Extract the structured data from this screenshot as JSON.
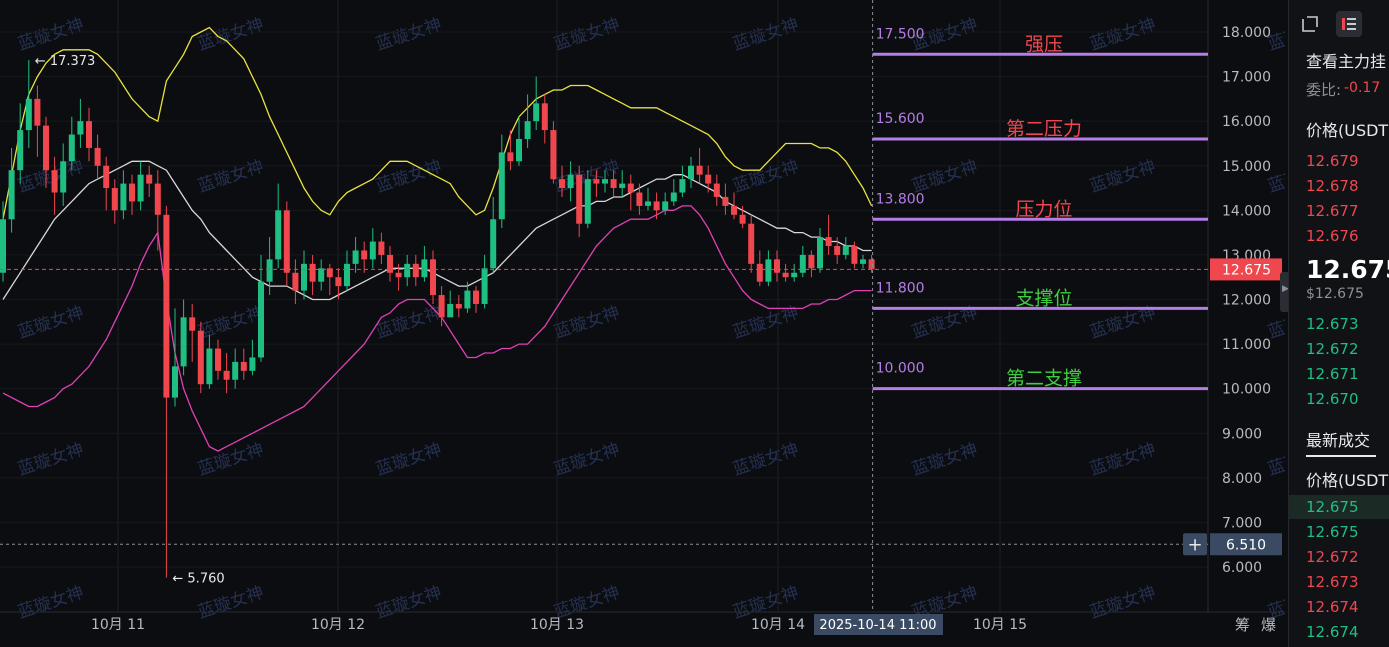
{
  "watermark": "蓝璇女神",
  "chart_data": {
    "type": "candlestick",
    "x_ticks": [
      "10月 11",
      "10月 12",
      "10月 13",
      "10月 14",
      "10月 15"
    ],
    "y_ticks": [
      "18.000",
      "17.000",
      "16.000",
      "15.000",
      "14.000",
      "13.000",
      "12.000",
      "11.000",
      "10.000",
      "9.000",
      "8.000",
      "7.000",
      "6.000"
    ],
    "ylim": [
      5.6,
      18.5
    ],
    "high_marker": "← 17.373",
    "low_marker": "← 5.760",
    "current_price": "12.675",
    "cursor_price": "6.510",
    "cursor_time": "2025-10-14 11:00",
    "levels": [
      {
        "value": 17.5,
        "value_label": "17.500",
        "name": "强压",
        "kind": "resistance"
      },
      {
        "value": 15.6,
        "value_label": "15.600",
        "name": "第二压力",
        "kind": "resistance"
      },
      {
        "value": 13.8,
        "value_label": "13.800",
        "name": "压力位",
        "kind": "resistance"
      },
      {
        "value": 11.8,
        "value_label": "11.800",
        "name": "支撑位",
        "kind": "support"
      },
      {
        "value": 10.0,
        "value_label": "10.000",
        "name": "第二支撑",
        "kind": "support"
      }
    ],
    "candles": [
      [
        12.6,
        13.8,
        14.2,
        12.4
      ],
      [
        13.8,
        14.9,
        15.4,
        13.5
      ],
      [
        14.9,
        15.8,
        16.4,
        14.6
      ],
      [
        15.8,
        16.5,
        17.373,
        15.4
      ],
      [
        16.5,
        15.9,
        16.8,
        15.2
      ],
      [
        15.9,
        14.9,
        16.1,
        14.5
      ],
      [
        14.9,
        14.4,
        15.2,
        13.9
      ],
      [
        14.4,
        15.1,
        15.5,
        14.1
      ],
      [
        15.1,
        15.7,
        16.1,
        14.9
      ],
      [
        15.7,
        16.0,
        16.5,
        15.4
      ],
      [
        16.0,
        15.4,
        16.3,
        15.1
      ],
      [
        15.4,
        15.0,
        15.7,
        14.7
      ],
      [
        15.0,
        14.5,
        15.2,
        14.0
      ],
      [
        14.5,
        14.0,
        14.7,
        13.7
      ],
      [
        14.0,
        14.6,
        14.9,
        13.8
      ],
      [
        14.6,
        14.2,
        14.8,
        13.9
      ],
      [
        14.2,
        14.8,
        15.1,
        14.0
      ],
      [
        14.8,
        14.6,
        15.0,
        14.3
      ],
      [
        14.6,
        13.9,
        14.9,
        13.1
      ],
      [
        13.9,
        9.8,
        14.1,
        5.76
      ],
      [
        9.8,
        10.5,
        11.8,
        9.6
      ],
      [
        10.5,
        11.6,
        12.0,
        10.3
      ],
      [
        11.6,
        11.3,
        11.9,
        10.6
      ],
      [
        11.3,
        10.1,
        11.5,
        9.9
      ],
      [
        10.1,
        10.9,
        11.2,
        10.0
      ],
      [
        10.9,
        10.4,
        11.1,
        10.2
      ],
      [
        10.4,
        10.2,
        10.8,
        9.9
      ],
      [
        10.2,
        10.6,
        10.9,
        10.0
      ],
      [
        10.6,
        10.4,
        10.9,
        10.2
      ],
      [
        10.4,
        10.7,
        11.1,
        10.3
      ],
      [
        10.7,
        12.4,
        13.0,
        10.6
      ],
      [
        12.4,
        12.9,
        13.4,
        12.1
      ],
      [
        12.9,
        14.0,
        14.6,
        12.7
      ],
      [
        14.0,
        12.6,
        14.2,
        12.3
      ],
      [
        12.6,
        12.2,
        12.9,
        11.9
      ],
      [
        12.2,
        12.8,
        13.1,
        12.0
      ],
      [
        12.8,
        12.4,
        13.0,
        12.1
      ],
      [
        12.4,
        12.7,
        12.9,
        12.2
      ],
      [
        12.7,
        12.5,
        12.8,
        12.1
      ],
      [
        12.5,
        12.3,
        12.7,
        12.0
      ],
      [
        12.3,
        12.8,
        13.1,
        12.2
      ],
      [
        12.8,
        13.1,
        13.4,
        12.6
      ],
      [
        13.1,
        12.9,
        13.3,
        12.6
      ],
      [
        12.9,
        13.3,
        13.6,
        12.7
      ],
      [
        13.3,
        13.0,
        13.5,
        12.8
      ],
      [
        13.0,
        12.6,
        13.2,
        12.4
      ],
      [
        12.6,
        12.5,
        12.8,
        12.2
      ],
      [
        12.5,
        12.8,
        13.0,
        12.3
      ],
      [
        12.8,
        12.5,
        13.0,
        12.3
      ],
      [
        12.5,
        12.9,
        13.2,
        12.4
      ],
      [
        12.9,
        12.1,
        13.1,
        11.9
      ],
      [
        12.1,
        11.6,
        12.3,
        11.4
      ],
      [
        11.6,
        11.9,
        12.2,
        11.7
      ],
      [
        11.9,
        11.8,
        12.1,
        11.6
      ],
      [
        11.8,
        12.2,
        12.4,
        11.7
      ],
      [
        12.2,
        11.9,
        12.3,
        11.7
      ],
      [
        11.9,
        12.7,
        13.0,
        11.8
      ],
      [
        12.7,
        13.8,
        14.3,
        12.6
      ],
      [
        13.8,
        15.3,
        15.7,
        13.6
      ],
      [
        15.3,
        15.1,
        15.8,
        14.9
      ],
      [
        15.1,
        15.6,
        16.1,
        15.0
      ],
      [
        15.6,
        16.0,
        16.6,
        15.4
      ],
      [
        16.0,
        16.4,
        17.0,
        15.8
      ],
      [
        16.4,
        15.8,
        16.6,
        15.5
      ],
      [
        15.8,
        14.7,
        16.0,
        14.6
      ],
      [
        14.7,
        14.5,
        15.0,
        14.3
      ],
      [
        14.5,
        14.8,
        15.1,
        14.2
      ],
      [
        14.8,
        13.7,
        15.0,
        13.4
      ],
      [
        13.7,
        14.7,
        14.9,
        13.6
      ],
      [
        14.7,
        14.6,
        14.9,
        14.3
      ],
      [
        14.6,
        14.7,
        14.9,
        14.4
      ],
      [
        14.7,
        14.5,
        14.9,
        14.3
      ],
      [
        14.5,
        14.6,
        14.9,
        14.3
      ],
      [
        14.6,
        14.4,
        14.8,
        14.0
      ],
      [
        14.4,
        14.1,
        14.6,
        13.9
      ],
      [
        14.1,
        14.2,
        14.5,
        14.0
      ],
      [
        14.2,
        14.0,
        14.4,
        13.8
      ],
      [
        14.0,
        14.2,
        14.4,
        13.9
      ],
      [
        14.2,
        14.4,
        14.7,
        14.1
      ],
      [
        14.4,
        14.7,
        15.0,
        14.3
      ],
      [
        14.7,
        15.0,
        15.2,
        14.5
      ],
      [
        15.0,
        14.8,
        15.4,
        14.6
      ],
      [
        14.8,
        14.6,
        15.0,
        14.4
      ],
      [
        14.6,
        14.3,
        14.8,
        14.1
      ],
      [
        14.3,
        14.1,
        14.6,
        13.9
      ],
      [
        14.1,
        13.9,
        14.4,
        13.8
      ],
      [
        13.9,
        13.7,
        14.1,
        13.6
      ],
      [
        13.7,
        12.8,
        13.9,
        12.6
      ],
      [
        12.8,
        12.4,
        13.1,
        12.3
      ],
      [
        12.4,
        12.9,
        13.1,
        12.3
      ],
      [
        12.9,
        12.6,
        13.1,
        12.4
      ],
      [
        12.6,
        12.5,
        12.8,
        12.4
      ],
      [
        12.5,
        12.6,
        12.8,
        12.4
      ],
      [
        12.6,
        13.0,
        13.2,
        12.5
      ],
      [
        13.0,
        12.7,
        13.1,
        12.5
      ],
      [
        12.7,
        13.4,
        13.6,
        12.6
      ],
      [
        13.4,
        13.2,
        13.9,
        13.0
      ],
      [
        13.2,
        13.0,
        13.4,
        12.8
      ],
      [
        13.0,
        13.2,
        13.4,
        12.9
      ],
      [
        13.2,
        12.8,
        13.3,
        12.7
      ],
      [
        12.8,
        12.9,
        13.0,
        12.7
      ],
      [
        12.9,
        12.675,
        13.0,
        12.6
      ]
    ],
    "series": [
      {
        "name": "upper",
        "color": "#e9e33f",
        "values": [
          13.8,
          14.8,
          15.8,
          16.6,
          17.0,
          17.3,
          17.5,
          17.6,
          17.6,
          17.6,
          17.6,
          17.5,
          17.3,
          17.1,
          16.8,
          16.5,
          16.3,
          16.1,
          16.0,
          16.9,
          17.2,
          17.5,
          17.9,
          18.0,
          18.1,
          17.9,
          17.8,
          17.6,
          17.4,
          17.0,
          16.6,
          16.1,
          15.7,
          15.3,
          14.9,
          14.5,
          14.2,
          14.0,
          13.9,
          14.2,
          14.4,
          14.5,
          14.6,
          14.7,
          14.9,
          15.1,
          15.1,
          15.1,
          15.0,
          14.9,
          14.8,
          14.7,
          14.6,
          14.3,
          14.1,
          13.9,
          14.0,
          14.5,
          15.1,
          15.7,
          16.1,
          16.3,
          16.5,
          16.6,
          16.7,
          16.7,
          16.8,
          16.8,
          16.8,
          16.7,
          16.6,
          16.5,
          16.4,
          16.3,
          16.3,
          16.3,
          16.3,
          16.2,
          16.1,
          16.0,
          15.9,
          15.8,
          15.7,
          15.5,
          15.2,
          15.0,
          14.9,
          14.9,
          14.9,
          15.1,
          15.3,
          15.5,
          15.5,
          15.5,
          15.5,
          15.4,
          15.4,
          15.3,
          15.1,
          14.8,
          14.5,
          14.1
        ]
      },
      {
        "name": "middle",
        "color": "#d8d8d8",
        "values": [
          12.0,
          12.3,
          12.6,
          12.9,
          13.2,
          13.5,
          13.8,
          14.0,
          14.2,
          14.4,
          14.6,
          14.7,
          14.8,
          14.9,
          15.0,
          15.1,
          15.1,
          15.1,
          15.0,
          14.9,
          14.6,
          14.3,
          14.0,
          13.8,
          13.5,
          13.3,
          13.1,
          12.9,
          12.7,
          12.5,
          12.4,
          12.3,
          12.3,
          12.3,
          12.2,
          12.1,
          12.0,
          12.0,
          12.0,
          12.1,
          12.2,
          12.3,
          12.4,
          12.5,
          12.6,
          12.7,
          12.7,
          12.7,
          12.7,
          12.7,
          12.6,
          12.5,
          12.4,
          12.3,
          12.3,
          12.4,
          12.5,
          12.6,
          12.8,
          13.0,
          13.2,
          13.4,
          13.6,
          13.7,
          13.8,
          13.9,
          14.0,
          14.1,
          14.1,
          14.2,
          14.2,
          14.3,
          14.3,
          14.4,
          14.5,
          14.6,
          14.7,
          14.7,
          14.8,
          14.8,
          14.7,
          14.6,
          14.5,
          14.4,
          14.2,
          14.1,
          14.0,
          13.9,
          13.8,
          13.7,
          13.6,
          13.6,
          13.5,
          13.5,
          13.4,
          13.4,
          13.3,
          13.3,
          13.2,
          13.2,
          13.1,
          13.1
        ]
      },
      {
        "name": "lower",
        "color": "#e041b6",
        "values": [
          9.9,
          9.8,
          9.7,
          9.6,
          9.6,
          9.7,
          9.8,
          10.0,
          10.1,
          10.3,
          10.5,
          10.8,
          11.1,
          11.5,
          11.9,
          12.3,
          12.8,
          13.2,
          13.5,
          12.0,
          10.8,
          10.0,
          9.5,
          9.1,
          8.7,
          8.6,
          8.7,
          8.8,
          8.9,
          9.0,
          9.1,
          9.2,
          9.3,
          9.4,
          9.5,
          9.6,
          9.8,
          10.0,
          10.2,
          10.4,
          10.6,
          10.8,
          11.0,
          11.3,
          11.6,
          11.7,
          11.9,
          12.0,
          12.0,
          12.0,
          11.8,
          11.6,
          11.3,
          11.0,
          10.7,
          10.7,
          10.8,
          10.8,
          10.9,
          10.9,
          11.0,
          11.0,
          11.2,
          11.4,
          11.7,
          12.0,
          12.3,
          12.6,
          12.9,
          13.2,
          13.4,
          13.6,
          13.7,
          13.8,
          13.8,
          13.8,
          13.9,
          14.0,
          14.0,
          14.1,
          14.1,
          13.9,
          13.6,
          13.2,
          12.8,
          12.5,
          12.2,
          12.0,
          11.9,
          11.8,
          11.8,
          11.8,
          11.8,
          11.8,
          11.9,
          11.9,
          12.0,
          12.0,
          12.1,
          12.2,
          12.2,
          12.2
        ]
      }
    ]
  },
  "panel": {
    "title": "查看主力挂",
    "wei_label": "委比:",
    "wei_value": "-0.17",
    "price_header": "价格(USDT",
    "asks": [
      "12.679",
      "12.678",
      "12.677",
      "12.676"
    ],
    "last_price": "12.675",
    "last_price_usd": "$12.675",
    "bids": [
      "12.673",
      "12.672",
      "12.671",
      "12.670"
    ],
    "trades_title": "最新成交",
    "trades_header": "价格(USDT",
    "trades": [
      {
        "price": "12.675",
        "side": "buy"
      },
      {
        "price": "12.675",
        "side": "buy"
      },
      {
        "price": "12.672",
        "side": "sell"
      },
      {
        "price": "12.673",
        "side": "sell"
      },
      {
        "price": "12.674",
        "side": "sell"
      },
      {
        "price": "12.674",
        "side": "buy"
      }
    ]
  },
  "bottom_tabs": {
    "chips": "筹",
    "burst": "爆"
  },
  "colors": {
    "up": "#1fbf83",
    "down": "#f0474f",
    "level_line": "#b57de6",
    "level_label": "#b57de6",
    "resistance_text": "#f0474f",
    "support_text": "#3fce3f"
  }
}
